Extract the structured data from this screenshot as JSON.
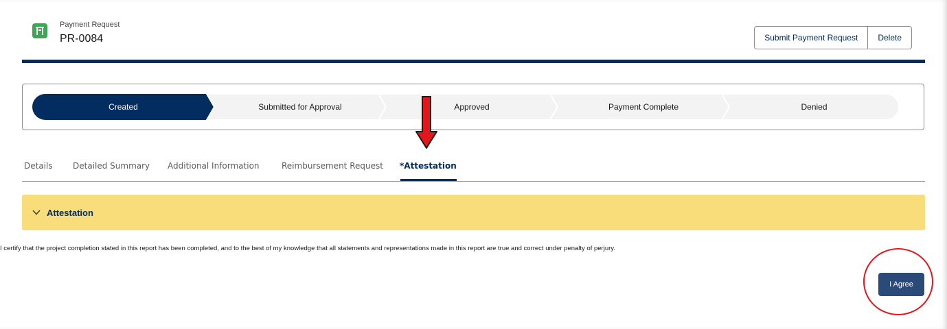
{
  "header": {
    "icon": "payment-request-icon",
    "object_label": "Payment Request",
    "record_name": "PR-0084",
    "actions": {
      "submit_label": "Submit Payment Request",
      "delete_label": "Delete"
    }
  },
  "path": {
    "steps": [
      {
        "label": "Created",
        "active": true
      },
      {
        "label": "Submitted for Approval",
        "active": false
      },
      {
        "label": "Approved",
        "active": false
      },
      {
        "label": "Payment Complete",
        "active": false
      },
      {
        "label": "Denied",
        "active": false
      }
    ]
  },
  "tabs": [
    {
      "label": "Details",
      "active": false
    },
    {
      "label": "Detailed Summary",
      "active": false
    },
    {
      "label": "Additional Information",
      "active": false
    },
    {
      "label": "Reimbursement Request",
      "active": false
    },
    {
      "label": "*Attestation",
      "active": true
    }
  ],
  "section": {
    "title": "Attestation",
    "body": "I certify that the project completion stated in this report has been completed, and to the best of my knowledge that all statements and representations made in this report are true and correct under penalty of perjury.",
    "agree_label": "I Agree"
  },
  "colors": {
    "brand_navy": "#032d60",
    "section_yellow": "#f9dd7b",
    "icon_green": "#3ba755",
    "annotation_red": "#e3161b",
    "button_blue": "#2a4a7a"
  }
}
